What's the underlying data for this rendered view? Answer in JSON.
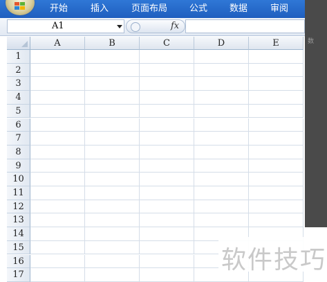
{
  "ribbon": {
    "tabs": [
      "开始",
      "插入",
      "页面布局",
      "公式",
      "数据",
      "审阅"
    ]
  },
  "side_panel": {
    "faded_text": "数"
  },
  "formula_bar": {
    "name_box": "A1",
    "fx_label": "fx",
    "formula": ""
  },
  "sheet": {
    "columns": [
      "A",
      "B",
      "C",
      "D",
      "E"
    ],
    "rows": [
      "1",
      "2",
      "3",
      "4",
      "5",
      "6",
      "7",
      "8",
      "9",
      "10",
      "11",
      "12",
      "13",
      "14",
      "15",
      "16",
      "17"
    ]
  },
  "watermark": "软件技巧",
  "colors": {
    "ribbon": "#2a6fd0",
    "header_bg": "#e4ebf4",
    "gridline": "#d4dde8"
  }
}
